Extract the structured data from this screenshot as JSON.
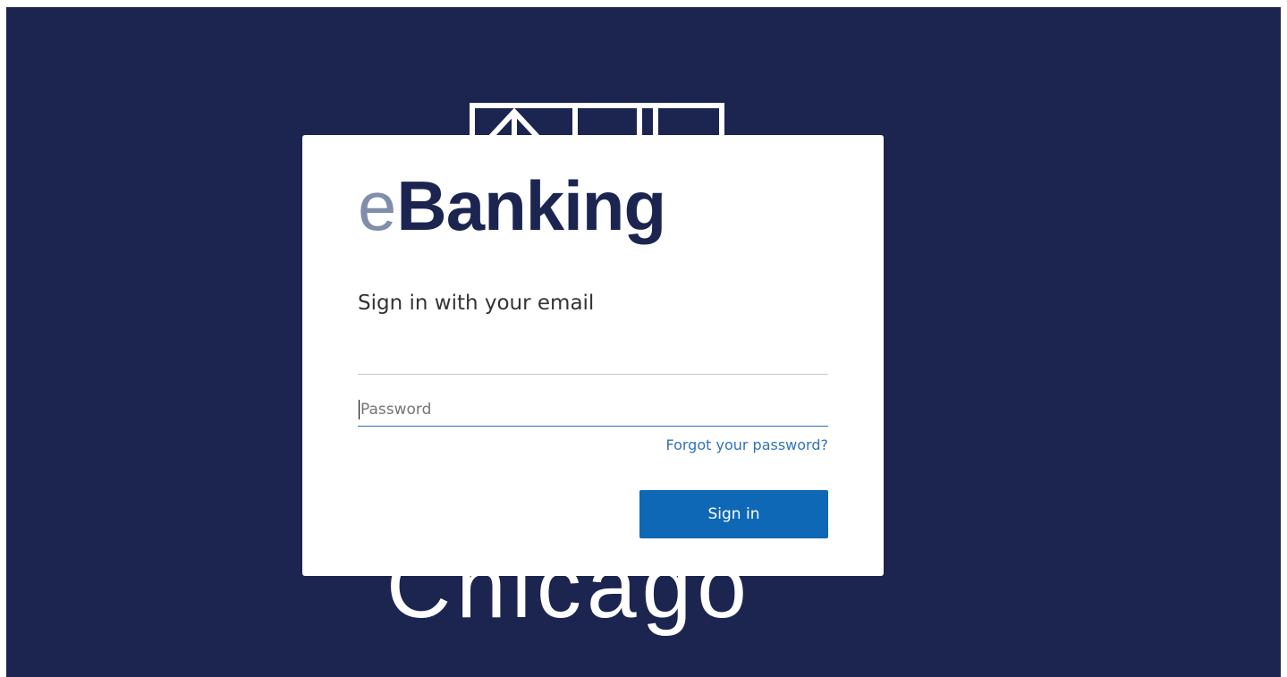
{
  "background": {
    "color": "#1b2550",
    "building_icon": "building-outline-icon",
    "city_text": "Chicago"
  },
  "logo": {
    "prefix": "e",
    "main": "Banking",
    "prefix_color": "#7f8eaa",
    "main_color": "#1b2550"
  },
  "form": {
    "heading": "Sign in with your email",
    "email_value": "",
    "password_placeholder": "Password",
    "password_value": "",
    "forgot_link": "Forgot your password?",
    "submit_label": "Sign in"
  },
  "colors": {
    "button": "#0e68b5",
    "link": "#2f74b8",
    "focus_underline": "#2f6fb5"
  }
}
